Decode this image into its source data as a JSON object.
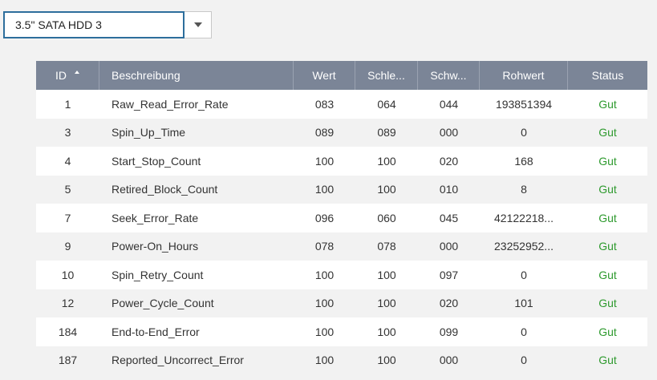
{
  "disk_select": {
    "selected": "3.5\" SATA HDD 3"
  },
  "colors": {
    "header_bg": "#7b8597",
    "status_good": "#2e9a2e",
    "select_border": "#2d6e9c"
  },
  "table": {
    "columns": [
      "ID",
      "Beschreibung",
      "Wert",
      "Schle...",
      "Schw...",
      "Rohwert",
      "Status"
    ],
    "sort": {
      "column": "ID",
      "direction": "ascending"
    },
    "rows": [
      {
        "id": "1",
        "desc": "Raw_Read_Error_Rate",
        "wert": "083",
        "schlechtester": "064",
        "schwelle": "044",
        "rohwert": "193851394",
        "status": "Gut"
      },
      {
        "id": "3",
        "desc": "Spin_Up_Time",
        "wert": "089",
        "schlechtester": "089",
        "schwelle": "000",
        "rohwert": "0",
        "status": "Gut"
      },
      {
        "id": "4",
        "desc": "Start_Stop_Count",
        "wert": "100",
        "schlechtester": "100",
        "schwelle": "020",
        "rohwert": "168",
        "status": "Gut"
      },
      {
        "id": "5",
        "desc": "Retired_Block_Count",
        "wert": "100",
        "schlechtester": "100",
        "schwelle": "010",
        "rohwert": "8",
        "status": "Gut"
      },
      {
        "id": "7",
        "desc": "Seek_Error_Rate",
        "wert": "096",
        "schlechtester": "060",
        "schwelle": "045",
        "rohwert": "42122218...",
        "status": "Gut"
      },
      {
        "id": "9",
        "desc": "Power-On_Hours",
        "wert": "078",
        "schlechtester": "078",
        "schwelle": "000",
        "rohwert": "23252952...",
        "status": "Gut"
      },
      {
        "id": "10",
        "desc": "Spin_Retry_Count",
        "wert": "100",
        "schlechtester": "100",
        "schwelle": "097",
        "rohwert": "0",
        "status": "Gut"
      },
      {
        "id": "12",
        "desc": "Power_Cycle_Count",
        "wert": "100",
        "schlechtester": "100",
        "schwelle": "020",
        "rohwert": "101",
        "status": "Gut"
      },
      {
        "id": "184",
        "desc": "End-to-End_Error",
        "wert": "100",
        "schlechtester": "100",
        "schwelle": "099",
        "rohwert": "0",
        "status": "Gut"
      },
      {
        "id": "187",
        "desc": "Reported_Uncorrect_Error",
        "wert": "100",
        "schlechtester": "100",
        "schwelle": "000",
        "rohwert": "0",
        "status": "Gut"
      }
    ]
  }
}
